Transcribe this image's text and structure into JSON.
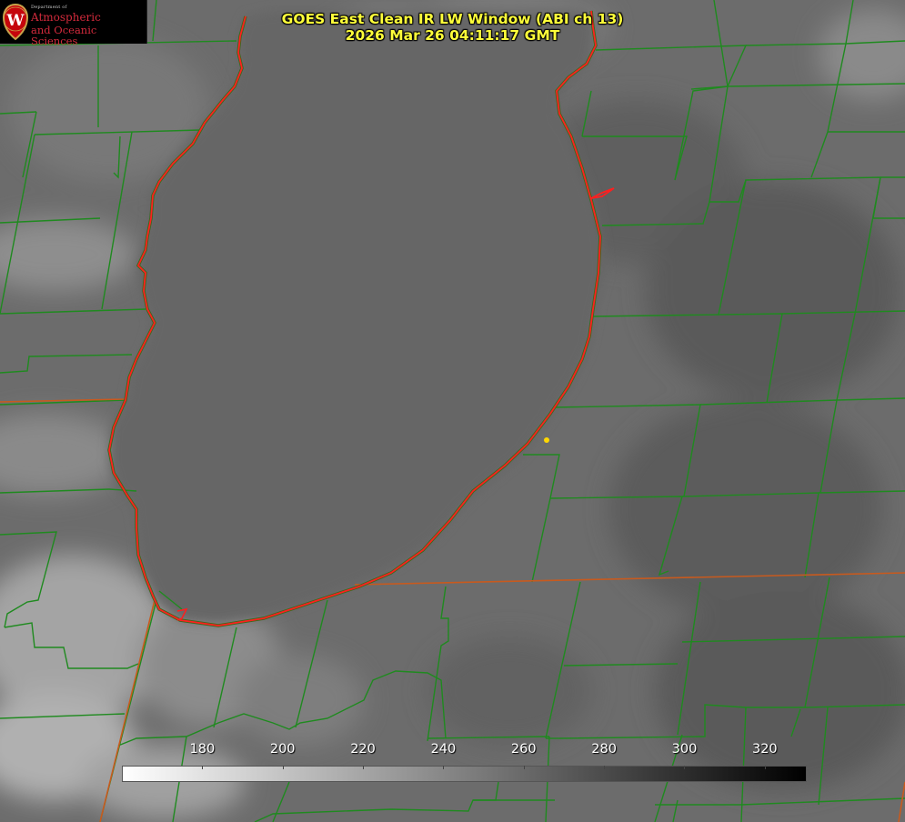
{
  "logo": {
    "department": "Department of",
    "line1": "Atmospheric",
    "line2": "and Oceanic Sciences",
    "seal_letter": "W",
    "seal_color": "#c5050c"
  },
  "title": {
    "line1": "GOES East Clean IR LW Window (ABI ch 13)",
    "line2": "2026 Mar 26 04:11:17 GMT",
    "color": "#ffff3a"
  },
  "colorbar": {
    "min": 160,
    "max": 330,
    "ticks": [
      180,
      200,
      220,
      240,
      260,
      280,
      300,
      320
    ],
    "start_color": "#ffffff",
    "end_color": "#000000"
  },
  "map_colors": {
    "county_lines": "#1f8a1f",
    "lake_shore": "#ff1f1f",
    "marker": "#ffd700"
  }
}
